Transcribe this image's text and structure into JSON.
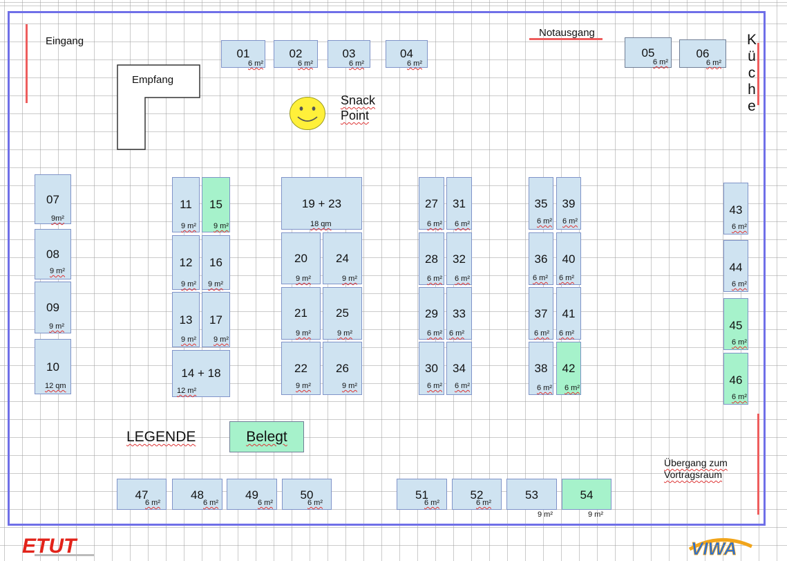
{
  "labels": {
    "entrance": "Eingang",
    "reception": "Empfang",
    "emergency_exit": "Notausgang",
    "snack": "Snack\nPoint",
    "kitchen": "K\nü\nc\nh\ne",
    "legend": "LEGENDE",
    "occupied": "Belegt",
    "passage": "Übergang zum\nVortragsraum"
  },
  "logos": {
    "left": "ETUT",
    "right": "VIWA"
  },
  "colors": {
    "free": "#cfe3f1",
    "occupied": "#a6f2cb",
    "hall_border": "#6f6fe8",
    "marker": "#ee5d5d",
    "smiley": "#fff03a"
  },
  "booths": [
    {
      "id": "01",
      "area": "6 m²",
      "occupied": false
    },
    {
      "id": "02",
      "area": "6 m²",
      "occupied": false
    },
    {
      "id": "03",
      "area": "6 m²",
      "occupied": false
    },
    {
      "id": "04",
      "area": "6 m²",
      "occupied": false
    },
    {
      "id": "05",
      "area": "6 m²",
      "occupied": false
    },
    {
      "id": "06",
      "area": "6 m²",
      "occupied": false
    },
    {
      "id": "07",
      "area": "9m²",
      "occupied": false
    },
    {
      "id": "08",
      "area": "9 m²",
      "occupied": false
    },
    {
      "id": "09",
      "area": "9 m²",
      "occupied": false
    },
    {
      "id": "10",
      "area": "12 qm",
      "occupied": false
    },
    {
      "id": "11",
      "area": "9 m²",
      "occupied": false
    },
    {
      "id": "15",
      "area": "9 m²",
      "occupied": true
    },
    {
      "id": "12",
      "area": "9 m²",
      "occupied": false
    },
    {
      "id": "16",
      "area": "9 m²",
      "occupied": false
    },
    {
      "id": "13",
      "area": "9 m²",
      "occupied": false
    },
    {
      "id": "17",
      "area": "9 m²",
      "occupied": false
    },
    {
      "id": "14 + 18",
      "area": "12 m²",
      "occupied": false
    },
    {
      "id": "19  +  23",
      "area": "18 qm",
      "occupied": false
    },
    {
      "id": "20",
      "area": "9 m²",
      "occupied": false
    },
    {
      "id": "24",
      "area": "9 m²",
      "occupied": false
    },
    {
      "id": "21",
      "area": "9 m²",
      "occupied": false
    },
    {
      "id": "25",
      "area": "9 m²",
      "occupied": false
    },
    {
      "id": "22",
      "area": "9 m²",
      "occupied": false
    },
    {
      "id": "26",
      "area": "9 m²",
      "occupied": false
    },
    {
      "id": "27",
      "area": "6 m²",
      "occupied": false
    },
    {
      "id": "31",
      "area": "6 m²",
      "occupied": false
    },
    {
      "id": "28",
      "area": "6 m²",
      "occupied": false
    },
    {
      "id": "32",
      "area": "6 m²",
      "occupied": false
    },
    {
      "id": "29",
      "area": "6 m²",
      "occupied": false
    },
    {
      "id": "33",
      "area": "6 m²",
      "occupied": false
    },
    {
      "id": "30",
      "area": "6 m²",
      "occupied": false
    },
    {
      "id": "34",
      "area": "6 m²",
      "occupied": false
    },
    {
      "id": "35",
      "area": "6 m²",
      "occupied": false
    },
    {
      "id": "39",
      "area": "6 m²",
      "occupied": false
    },
    {
      "id": "36",
      "area": "6 m²",
      "occupied": false
    },
    {
      "id": "40",
      "area": "6 m²",
      "occupied": false
    },
    {
      "id": "37",
      "area": "6 m²",
      "occupied": false
    },
    {
      "id": "41",
      "area": "6 m²",
      "occupied": false
    },
    {
      "id": "38",
      "area": "6 m²",
      "occupied": false
    },
    {
      "id": "42",
      "area": "6 m²",
      "occupied": true
    },
    {
      "id": "43",
      "area": "6 m²",
      "occupied": false
    },
    {
      "id": "44",
      "area": "6 m²",
      "occupied": false
    },
    {
      "id": "45",
      "area": "6 m²",
      "occupied": true
    },
    {
      "id": "46",
      "area": "6 m²",
      "occupied": true
    },
    {
      "id": "47",
      "area": "6 m²",
      "occupied": false
    },
    {
      "id": "48",
      "area": "6 m²",
      "occupied": false
    },
    {
      "id": "49",
      "area": "6 m²",
      "occupied": false
    },
    {
      "id": "50",
      "area": "6 m²",
      "occupied": false
    },
    {
      "id": "51",
      "area": "6 m²",
      "occupied": false
    },
    {
      "id": "52",
      "area": "6 m²",
      "occupied": false
    },
    {
      "id": "53",
      "area": "9 m²",
      "occupied": false
    },
    {
      "id": "54",
      "area": "9 m²",
      "occupied": true
    }
  ]
}
